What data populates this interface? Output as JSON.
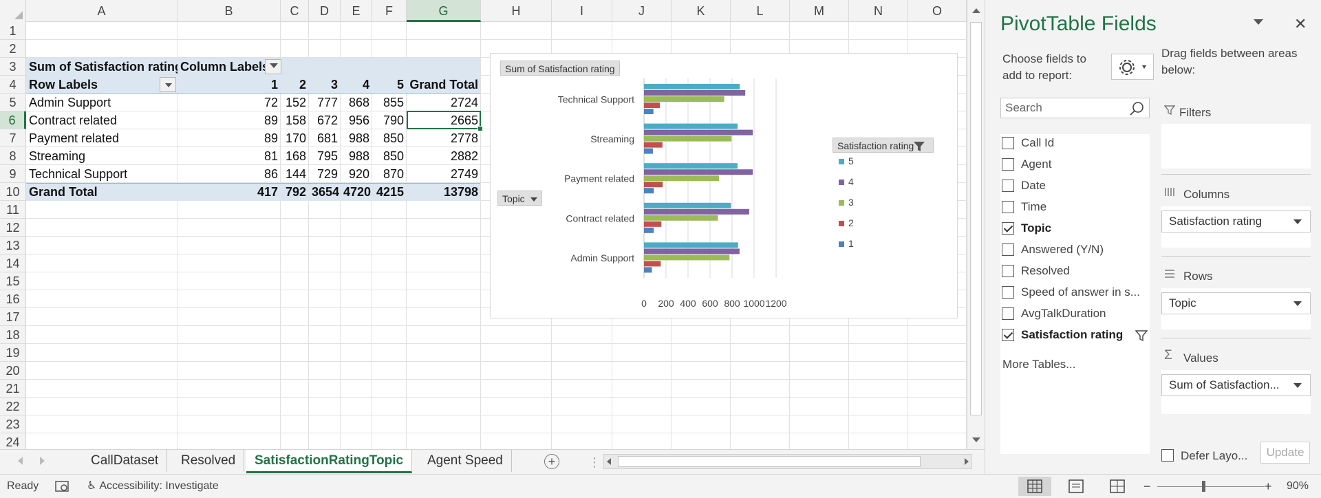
{
  "sheet": {
    "columns": [
      "A",
      "B",
      "C",
      "D",
      "E",
      "F",
      "G",
      "H",
      "I",
      "J",
      "K",
      "L",
      "M",
      "N",
      "O"
    ],
    "selected_column": "G",
    "rows": [
      "1",
      "2",
      "3",
      "4",
      "5",
      "6",
      "7",
      "8",
      "9",
      "10",
      "11",
      "12",
      "13",
      "14",
      "15",
      "16",
      "17",
      "18",
      "19",
      "20",
      "21",
      "22",
      "23",
      "24"
    ],
    "selected_row": "6",
    "selected_cell": "G6"
  },
  "pivot": {
    "sum_label": "Sum of Satisfaction rating",
    "column_labels": "Column Labels",
    "row_labels": "Row Labels",
    "col_headers": [
      "1",
      "2",
      "3",
      "4",
      "5",
      "Grand Total"
    ],
    "rows": [
      {
        "label": "Admin Support",
        "values": [
          "72",
          "152",
          "777",
          "868",
          "855",
          "2724"
        ]
      },
      {
        "label": "Contract related",
        "values": [
          "89",
          "158",
          "672",
          "956",
          "790",
          "2665"
        ]
      },
      {
        "label": "Payment related",
        "values": [
          "89",
          "170",
          "681",
          "988",
          "850",
          "2778"
        ]
      },
      {
        "label": "Streaming",
        "values": [
          "81",
          "168",
          "795",
          "988",
          "850",
          "2882"
        ]
      },
      {
        "label": "Technical Support",
        "values": [
          "86",
          "144",
          "729",
          "920",
          "870",
          "2749"
        ]
      }
    ],
    "grand_total": {
      "label": "Grand Total",
      "values": [
        "417",
        "792",
        "3654",
        "4720",
        "4215",
        "13798"
      ]
    }
  },
  "chart_data": {
    "type": "bar",
    "orientation": "horizontal",
    "title": "Sum of Satisfaction rating",
    "field_button": "Topic",
    "legend_title": "Satisfaction rating",
    "legend_position": "right",
    "categories": [
      "Admin Support",
      "Contract related",
      "Payment related",
      "Streaming",
      "Technical Support"
    ],
    "series": [
      {
        "name": "1",
        "color": "#4f81bd",
        "values": [
          72,
          89,
          89,
          81,
          86
        ]
      },
      {
        "name": "2",
        "color": "#c0504d",
        "values": [
          152,
          158,
          170,
          168,
          144
        ]
      },
      {
        "name": "3",
        "color": "#9bbb59",
        "values": [
          777,
          672,
          681,
          795,
          729
        ]
      },
      {
        "name": "4",
        "color": "#8064a2",
        "values": [
          868,
          956,
          988,
          988,
          920
        ]
      },
      {
        "name": "5",
        "color": "#4bacc6",
        "values": [
          855,
          790,
          850,
          850,
          870
        ]
      }
    ],
    "xlim": [
      0,
      1200
    ],
    "xticks": [
      "0",
      "200",
      "400",
      "600",
      "800",
      "1000",
      "1200"
    ],
    "grid": true
  },
  "tabs": {
    "items": [
      "CallDataset",
      "Resolved",
      "SatisfactionRatingTopic",
      "Agent Speed"
    ],
    "active": "SatisfactionRatingTopic"
  },
  "status": {
    "ready": "Ready",
    "accessibility": "Accessibility: Investigate",
    "zoom": "90%",
    "zoom_minus": "−",
    "zoom_plus": "+"
  },
  "pane": {
    "title": "PivotTable Fields",
    "choose_fields": "Choose fields to add to report:",
    "drag_fields": "Drag fields between areas below:",
    "search_placeholder": "Search",
    "fields": [
      {
        "label": "Call Id",
        "checked": false
      },
      {
        "label": "Agent",
        "checked": false
      },
      {
        "label": "Date",
        "checked": false
      },
      {
        "label": "Time",
        "checked": false
      },
      {
        "label": "Topic",
        "checked": true
      },
      {
        "label": "Answered (Y/N)",
        "checked": false
      },
      {
        "label": "Resolved",
        "checked": false
      },
      {
        "label": "Speed of answer in s...",
        "checked": false
      },
      {
        "label": "AvgTalkDuration",
        "checked": false
      },
      {
        "label": "Satisfaction rating",
        "checked": true
      }
    ],
    "more_tables": "More Tables...",
    "areas": {
      "filters": "Filters",
      "columns": "Columns",
      "columns_item": "Satisfaction rating",
      "rows": "Rows",
      "rows_item": "Topic",
      "values": "Values",
      "values_item": "Sum of Satisfaction..."
    },
    "defer": "Defer Layo...",
    "update": "Update"
  }
}
